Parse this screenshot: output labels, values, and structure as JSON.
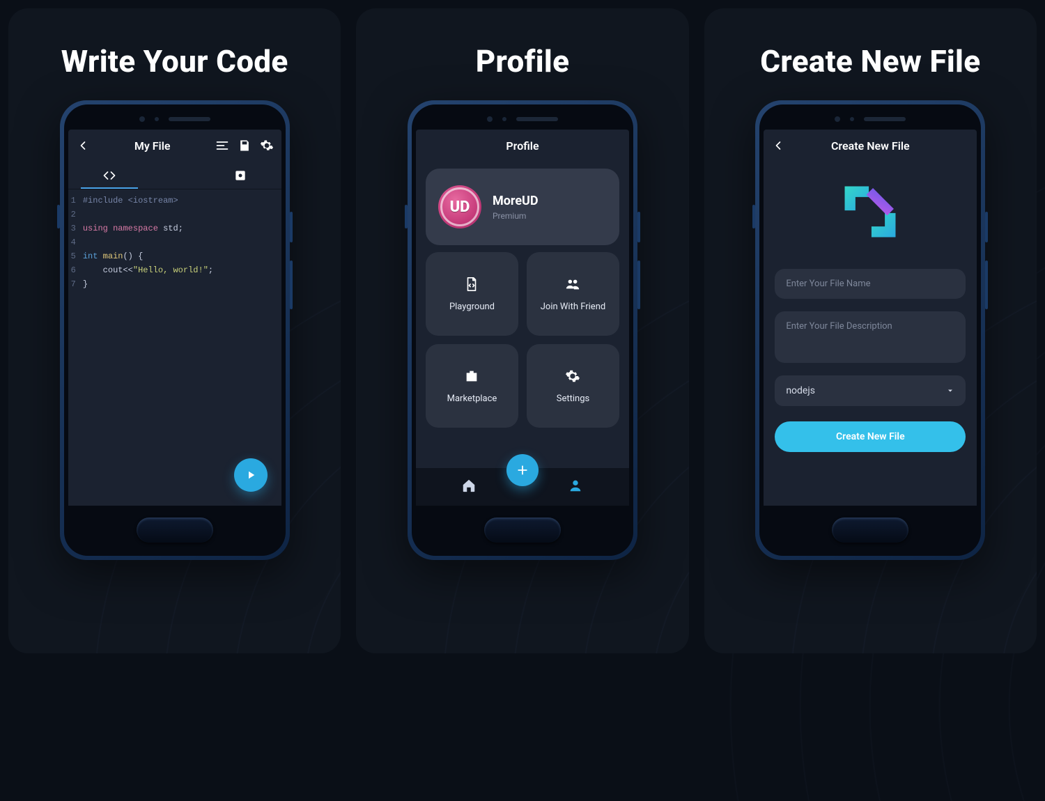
{
  "panels": {
    "a": {
      "headline": "Write Your Code"
    },
    "b": {
      "headline": "Profile"
    },
    "c": {
      "headline": "Create New File"
    }
  },
  "editor": {
    "title": "My File",
    "lines": [
      "1",
      "2",
      "3",
      "4",
      "5",
      "6",
      "7"
    ],
    "code": {
      "l1_include": "#include <iostream>",
      "l3_using": "using",
      "l3_ns": "namespace",
      "l3_std": " std;",
      "l5_int": "int",
      "l5_main": " main",
      "l5_rest": "() {",
      "l6_a": "    cout<<",
      "l6_str": "\"Hello, world!\"",
      "l6_b": ";",
      "l7": "}"
    }
  },
  "profile": {
    "title": "Profile",
    "avatar_text": "UD",
    "name": "MoreUD",
    "subtitle": "Premium",
    "tiles": {
      "playground": "Playground",
      "join": "Join With Friend",
      "market": "Marketplace",
      "settings": "Settings"
    }
  },
  "create": {
    "title": "Create New File",
    "placeholder_name": "Enter Your File Name",
    "placeholder_desc": "Enter Your File Description",
    "select_value": "nodejs",
    "cta": "Create New File"
  }
}
